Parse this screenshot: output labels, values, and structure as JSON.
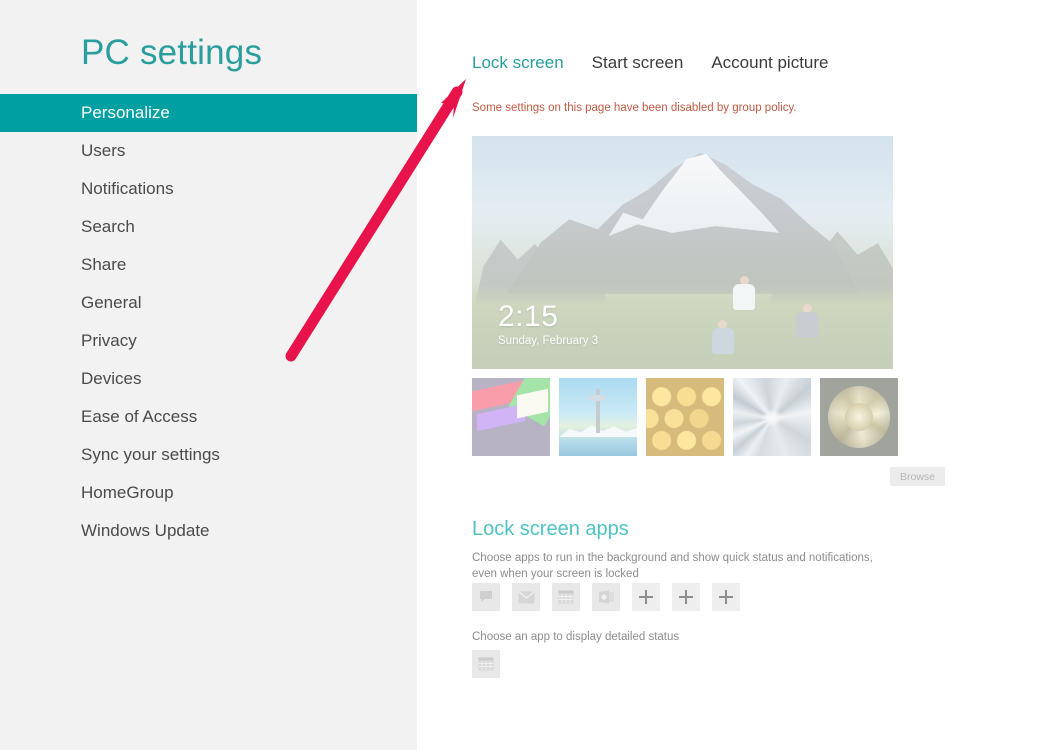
{
  "sidebar": {
    "title": "PC settings",
    "items": [
      {
        "label": "Personalize",
        "active": true
      },
      {
        "label": "Users",
        "active": false
      },
      {
        "label": "Notifications",
        "active": false
      },
      {
        "label": "Search",
        "active": false
      },
      {
        "label": "Share",
        "active": false
      },
      {
        "label": "General",
        "active": false
      },
      {
        "label": "Privacy",
        "active": false
      },
      {
        "label": "Devices",
        "active": false
      },
      {
        "label": "Ease of Access",
        "active": false
      },
      {
        "label": "Sync your settings",
        "active": false
      },
      {
        "label": "HomeGroup",
        "active": false
      },
      {
        "label": "Windows Update",
        "active": false
      }
    ]
  },
  "content": {
    "tabs": [
      {
        "label": "Lock screen",
        "active": true
      },
      {
        "label": "Start screen",
        "active": false
      },
      {
        "label": "Account picture",
        "active": false
      }
    ],
    "policy_warning": "Some settings on this page have been disabled by group policy.",
    "preview": {
      "time": "2:15",
      "date": "Sunday, February 3",
      "image_description": "mountain-landscape-with-hikers"
    },
    "thumbnails": [
      {
        "name": "abstract-geometric-thumbnail"
      },
      {
        "name": "space-needle-thumbnail"
      },
      {
        "name": "honeycomb-thumbnail"
      },
      {
        "name": "light-tunnel-thumbnail"
      },
      {
        "name": "nautilus-shell-thumbnail"
      }
    ],
    "browse_label": "Browse",
    "apps_section": {
      "heading": "Lock screen apps",
      "description": "Choose apps to run in the background and show quick status and notifications, even when your screen is locked",
      "tiles": [
        {
          "icon": "messaging-icon",
          "type": "app"
        },
        {
          "icon": "mail-icon",
          "type": "app"
        },
        {
          "icon": "calendar-icon",
          "type": "app"
        },
        {
          "icon": "weather-icon",
          "type": "app"
        },
        {
          "icon": "plus-icon",
          "type": "add"
        },
        {
          "icon": "plus-icon",
          "type": "add"
        },
        {
          "icon": "plus-icon",
          "type": "add"
        }
      ]
    },
    "detail_section": {
      "description": "Choose an app to display detailed status",
      "tile": {
        "icon": "calendar-icon",
        "type": "app"
      }
    }
  },
  "annotation": {
    "type": "arrow",
    "color": "#e8134b",
    "points_to": "Lock screen"
  },
  "colors": {
    "accent_teal": "#00a0a2",
    "title_teal": "#2a9d9d",
    "heading_teal": "#4fc3c3",
    "warning_red": "#c05a44",
    "sidebar_bg": "#f2f2f2",
    "annotation_pink": "#e8134b"
  }
}
